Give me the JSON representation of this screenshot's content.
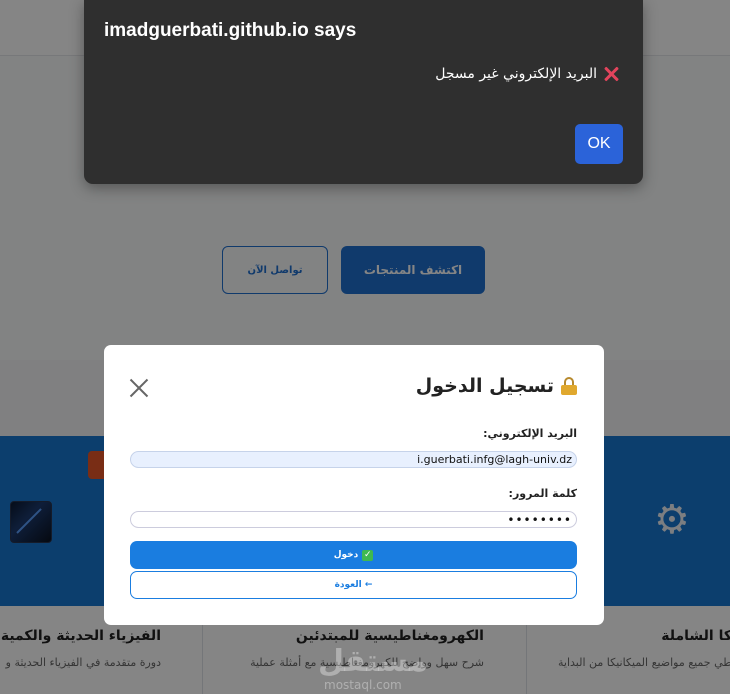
{
  "background": {
    "hero_buttons": {
      "explore_label": "اكتشف المنتجات",
      "contact_label": "تواصل الآن"
    },
    "cards": [
      {
        "title": "الفيزياء الحديثة والكمية",
        "description": "دورة متقدمة في الفيزياء الحديثة و"
      },
      {
        "title": "الكهرومغناطيسية للمبتدئين",
        "description": "شرح سهل وواضح للكهرومغناطيسية مع أمثلة عملية"
      },
      {
        "title": "كا الشاملة",
        "description": "طي جميع مواضيع الميكانيكا من البداية"
      }
    ],
    "watermark": {
      "logo": "مستقل",
      "sub": "mostaql.com"
    }
  },
  "login_modal": {
    "title": "تسجيل الدخول",
    "email_label": "البريد الإلكتروني:",
    "email_value": "i.guerbati.infg@lagh-univ.dz",
    "password_label": "كلمة المرور:",
    "password_value": "••••••••",
    "login_label": "دخول",
    "back_label": "← العودة",
    "icons": {
      "title": "lock-icon",
      "close": "close-icon",
      "login": "check-icon"
    }
  },
  "alert": {
    "title": "imadguerbati.github.io says",
    "message": "البريد الإلكتروني غير مسجل",
    "ok_label": "OK",
    "icon": "cross-icon",
    "colors": {
      "background": "#2f2f2f",
      "ok_button": "#2b63d9",
      "cross": "#e2445c"
    }
  }
}
